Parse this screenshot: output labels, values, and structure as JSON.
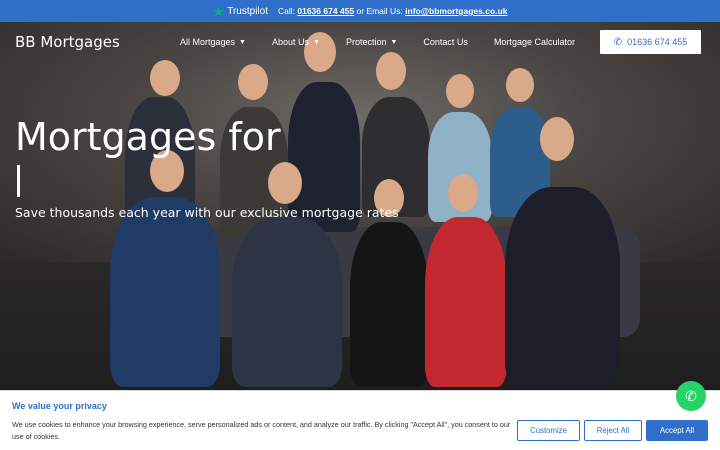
{
  "topbar": {
    "trustpilot": "Trustpilot",
    "call_prefix": "Call:",
    "phone": "01636 674 455",
    "email_prefix": "or Email Us:",
    "email": "info@bbmortgages.co.uk"
  },
  "nav": {
    "logo": "BB Mortgages",
    "items": [
      {
        "label": "All Mortgages",
        "dropdown": true
      },
      {
        "label": "About Us",
        "dropdown": true
      },
      {
        "label": "Protection",
        "dropdown": true
      },
      {
        "label": "Contact Us",
        "dropdown": false
      },
      {
        "label": "Mortgage Calculator",
        "dropdown": false
      }
    ],
    "phone_button": "01636 674 455"
  },
  "hero": {
    "headline": "Mortgages for",
    "cursor": "|",
    "subtitle": "Save thousands each year with our exclusive mortgage rates"
  },
  "cookie": {
    "title": "We value your privacy",
    "text": "We use cookies to enhance your browsing experience, serve personalized ads or content, and analyze our traffic. By clicking \"Accept All\", you consent to our use of cookies.",
    "customize": "Customize",
    "reject": "Reject All",
    "accept": "Accept All"
  },
  "colors": {
    "brand": "#2f6fc9",
    "whatsapp": "#25d366",
    "trustpilot_star": "#00b67a"
  },
  "icons": {
    "trustpilot": "star-icon",
    "phone": "phone-icon",
    "chevron": "chevron-down-icon",
    "whatsapp": "whatsapp-icon"
  }
}
